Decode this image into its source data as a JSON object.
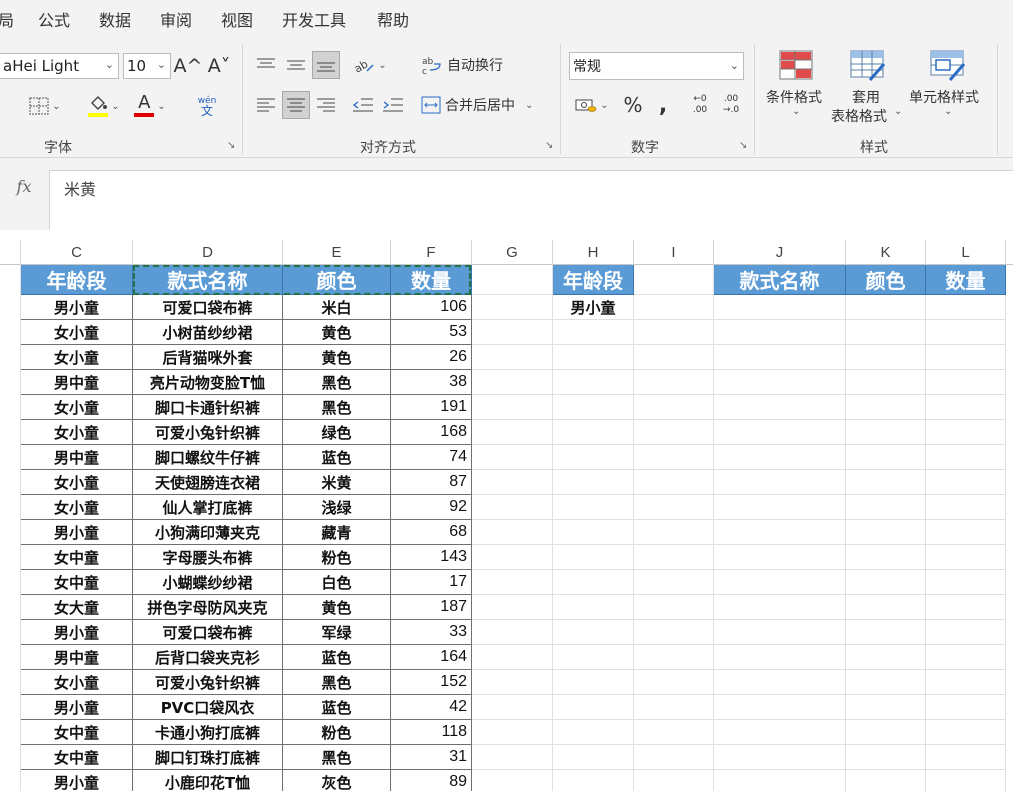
{
  "menu": [
    "局",
    "公式",
    "数据",
    "审阅",
    "视图",
    "开发工具",
    "帮助"
  ],
  "ribbon": {
    "font": {
      "font_name": "aHei Light",
      "font_size": "10",
      "grow_glyph": "A^",
      "shrink_glyph": "A˅",
      "wen_top": "wén",
      "wen_bottom": "文",
      "group_label": "字体",
      "highlight_color": "#ffff00",
      "font_color": "#e00000"
    },
    "alignment": {
      "wrap_text": "自动换行",
      "merge_center": "合并后居中",
      "group_label": "对齐方式"
    },
    "number": {
      "format": "常规",
      "percent": "%",
      "comma": ",",
      "inc_decimal_top": "←0",
      "inc_decimal_bottom": ".00",
      "dec_decimal_top": ".00",
      "dec_decimal_bottom": "→.0",
      "group_label": "数字"
    },
    "styles": {
      "conditional": "条件格式",
      "table_format_1": "套用",
      "table_format_2": "表格格式",
      "cell_styles": "单元格样式",
      "group_label": "样式"
    }
  },
  "formula_bar": {
    "fx": "fx",
    "content": "米黄"
  },
  "columns": [
    "C",
    "D",
    "E",
    "F",
    "G",
    "H",
    "I",
    "J",
    "K",
    "L"
  ],
  "table": {
    "headers": [
      "年龄段",
      "款式名称",
      "颜色",
      "数量"
    ],
    "rows": [
      [
        "男小童",
        "可爱口袋布裤",
        "米白",
        "106"
      ],
      [
        "女小童",
        "小树苗纱纱裙",
        "黄色",
        "53"
      ],
      [
        "女小童",
        "后背猫咪外套",
        "黄色",
        "26"
      ],
      [
        "男中童",
        "亮片动物变脸T恤",
        "黑色",
        "38"
      ],
      [
        "女小童",
        "脚口卡通针织裤",
        "黑色",
        "191"
      ],
      [
        "女小童",
        "可爱小兔针织裤",
        "绿色",
        "168"
      ],
      [
        "男中童",
        "脚口螺纹牛仔裤",
        "蓝色",
        "74"
      ],
      [
        "女小童",
        "天使翅膀连衣裙",
        "米黄",
        "87"
      ],
      [
        "女小童",
        "仙人掌打底裤",
        "浅绿",
        "92"
      ],
      [
        "男小童",
        "小狗满印薄夹克",
        "藏青",
        "68"
      ],
      [
        "女中童",
        "字母腰头布裤",
        "粉色",
        "143"
      ],
      [
        "女中童",
        "小蝴蝶纱纱裙",
        "白色",
        "17"
      ],
      [
        "女大童",
        "拼色字母防风夹克",
        "黄色",
        "187"
      ],
      [
        "男小童",
        "可爱口袋布裤",
        "军绿",
        "33"
      ],
      [
        "男中童",
        "后背口袋夹克衫",
        "蓝色",
        "164"
      ],
      [
        "女小童",
        "可爱小兔针织裤",
        "黑色",
        "152"
      ],
      [
        "男小童",
        "PVC口袋风衣",
        "蓝色",
        "42"
      ],
      [
        "女中童",
        "卡通小狗打底裤",
        "粉色",
        "118"
      ],
      [
        "女中童",
        "脚口钉珠打底裤",
        "黑色",
        "31"
      ],
      [
        "男小童",
        "小鹿印花T恤",
        "灰色",
        "89"
      ]
    ]
  },
  "criteria": {
    "header": "年龄段",
    "value": "男小童"
  },
  "result": {
    "headers": [
      "款式名称",
      "颜色",
      "数量"
    ]
  },
  "colors": {
    "header_fill": "#5b9bd5",
    "marquee": "#217346"
  }
}
